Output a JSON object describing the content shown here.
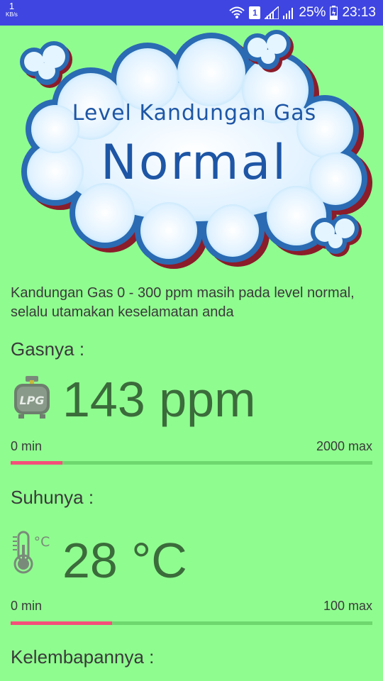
{
  "status_bar": {
    "speed_value": "1",
    "speed_unit": "KB/s",
    "sim_label": "1",
    "battery": "25%",
    "time": "23:13"
  },
  "banner": {
    "subtitle": "Level Kandungan Gas",
    "status": "Normal"
  },
  "description": "Kandungan Gas 0 - 300 ppm masih pada level normal, selalu utamakan keselamatan anda",
  "gas": {
    "label": "Gasnya :",
    "icon_text": "LPG",
    "reading": "143 ppm",
    "min_label": "0 min",
    "max_label": "2000 max",
    "level_fraction": 0.143
  },
  "temperature": {
    "label": "Suhunya :",
    "icon_unit": "°C",
    "reading": "28 °C",
    "min_label": "0 min",
    "max_label": "100 max",
    "level_fraction": 0.28
  },
  "humidity": {
    "label": "Kelembapannya :"
  },
  "colors": {
    "background": "#8ffc8f",
    "status_bar": "#3e45e0",
    "bar_fill": "#f44f7a",
    "bar_track": "#6ed86e",
    "reading_text": "#3b6b3b"
  }
}
